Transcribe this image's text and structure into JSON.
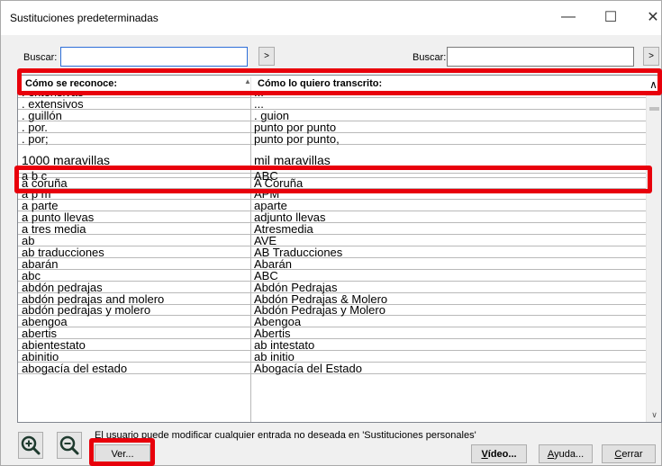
{
  "window": {
    "title": "Sustituciones predeterminadas",
    "minimize_glyph": "—",
    "maximize_glyph": "☐",
    "close_glyph": "✕"
  },
  "search": {
    "label1": "Buscar:",
    "value1": "",
    "go1": ">",
    "label2": "Buscar:",
    "value2": "",
    "go2": ">"
  },
  "table": {
    "columns": [
      "Cómo se reconoce:",
      "Cómo lo quiero transcrito:"
    ],
    "sort_indicator": "▲",
    "scroll_up": "∧",
    "scroll_down": "∨",
    "top_partial": [
      ". extensivas",
      "..."
    ],
    "rows_before": [
      [
        ". extensivos",
        "..."
      ],
      [
        ". guillón",
        ". guion"
      ],
      [
        ". por.",
        "punto por punto"
      ],
      [
        ". por;",
        "punto por punto,"
      ]
    ],
    "selected_row": [
      "1000 maravillas",
      "mil maravillas"
    ],
    "partial_after": [
      "a b c",
      "ABC"
    ],
    "rows_after": [
      [
        "a coruña",
        "A Coruña"
      ],
      [
        "a p m",
        "APM"
      ],
      [
        "a parte",
        "aparte"
      ],
      [
        "a punto llevas",
        "adjunto llevas"
      ],
      [
        "a tres media",
        "Atresmedia"
      ],
      [
        "ab",
        "AVE"
      ],
      [
        "ab traducciones",
        "AB Traducciones"
      ],
      [
        "abarán",
        "Abarán"
      ],
      [
        "abc",
        "ABC"
      ],
      [
        "abdón pedrajas",
        "Abdón Pedrajas"
      ],
      [
        "abdón pedrajas and molero",
        "Abdón Pedrajas & Molero"
      ],
      [
        "abdón pedrajas y molero",
        "Abdón Pedrajas y Molero"
      ],
      [
        "abengoa",
        "Abengoa"
      ],
      [
        "abertis",
        "Abertis"
      ],
      [
        "abientestato",
        "ab intestato"
      ],
      [
        "abinitio",
        "ab initio"
      ],
      [
        "abogacía del estado",
        "Abogacía del Estado"
      ]
    ]
  },
  "footer": {
    "info": "El usuario puede modificar cualquier entrada no deseada en 'Sustituciones personales'",
    "ver": "Ver...",
    "video_u": "V",
    "video_rest": "ídeo...",
    "ayuda_u": "A",
    "ayuda_rest": "yuda...",
    "cerrar_u": "C",
    "cerrar_rest": "errar"
  },
  "icons": {
    "zoom_in": "zoom-in-icon",
    "zoom_out": "zoom-out-icon"
  },
  "colors": {
    "highlight": "#e8000b",
    "focus": "#2e6fd8"
  }
}
